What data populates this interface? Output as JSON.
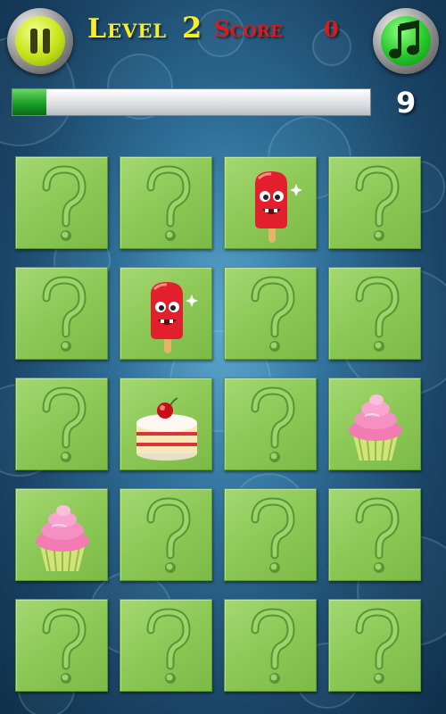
{
  "hud": {
    "level_label": "Level",
    "level_number": "2",
    "score_label": "Score",
    "score_value": "0",
    "moves_value": "9",
    "progress_fraction": 0.095,
    "pause_icon": "pause-icon",
    "music_icon": "music-note-icon"
  },
  "board": {
    "rows": 5,
    "cols": 4,
    "tiles": [
      "hidden",
      "hidden",
      "popsicle",
      "hidden",
      "hidden",
      "popsicle",
      "hidden",
      "hidden",
      "hidden",
      "cake",
      "hidden",
      "cupcake",
      "cupcake",
      "hidden",
      "hidden",
      "hidden",
      "hidden",
      "hidden",
      "hidden",
      "hidden"
    ]
  },
  "colors": {
    "tile_green": "#8cc856",
    "level_yellow": "#f7ee2a",
    "score_red": "#d81c1c",
    "progress_green": "#169a23"
  }
}
